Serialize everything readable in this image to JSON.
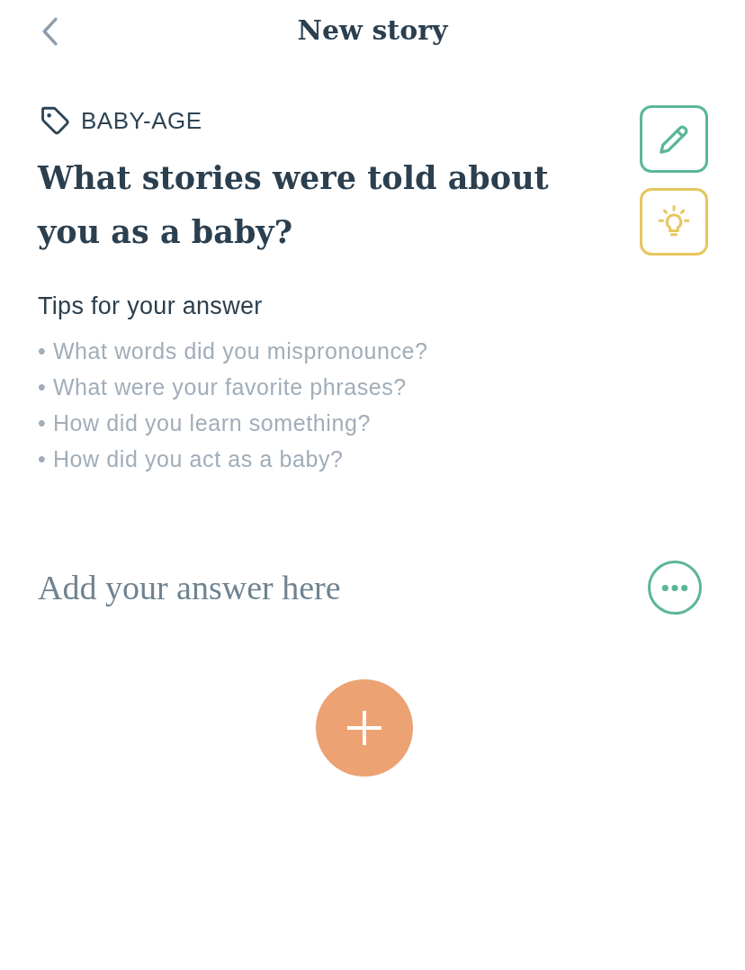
{
  "header": {
    "title": "New story"
  },
  "prompt": {
    "tag": "BABY-AGE",
    "question": "What stories were told about you as a baby?"
  },
  "tips": {
    "heading": "Tips for your answer",
    "items": [
      "• What words did you mispronounce?",
      "• What were your favorite phrases?",
      "• How did you learn something?",
      "• How did you act as a baby?"
    ]
  },
  "answer": {
    "placeholder": "Add your answer here"
  }
}
